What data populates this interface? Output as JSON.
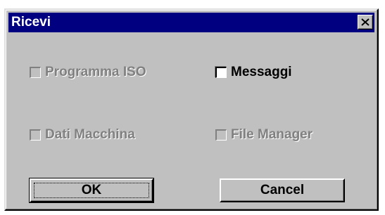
{
  "window": {
    "title": "Ricevi",
    "close_icon": "close-icon"
  },
  "options": [
    {
      "label": "Programma ISO",
      "enabled": false,
      "checked": false
    },
    {
      "label": "Messaggi",
      "enabled": true,
      "checked": false
    },
    {
      "label": "Dati Macchina",
      "enabled": false,
      "checked": false
    },
    {
      "label": "File Manager",
      "enabled": false,
      "checked": false
    }
  ],
  "buttons": {
    "ok_label": "OK",
    "cancel_label": "Cancel"
  },
  "colors": {
    "titlebar": "#000080",
    "face": "#c0c0c0",
    "disabled_text": "#808080"
  }
}
